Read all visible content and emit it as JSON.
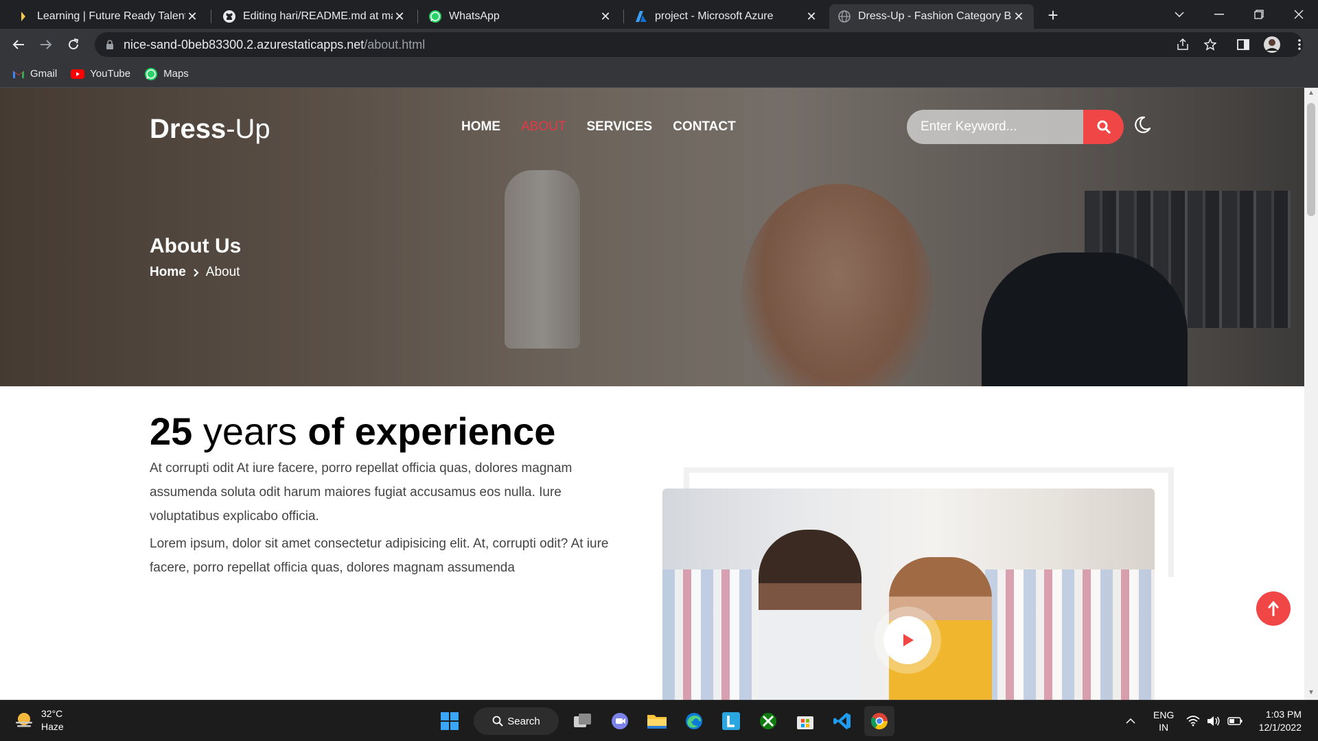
{
  "browser": {
    "tabs": [
      {
        "title": "Learning | Future Ready Talent",
        "icon": "future-ready-talent-icon"
      },
      {
        "title": "Editing hari/README.md at main",
        "icon": "github-icon"
      },
      {
        "title": "WhatsApp",
        "icon": "whatsapp-icon"
      },
      {
        "title": "project - Microsoft Azure",
        "icon": "azure-icon"
      },
      {
        "title": "Dress-Up - Fashion Category Boo",
        "icon": "globe-icon",
        "active": true
      }
    ],
    "url_host": "nice-sand-0beb83300.2.azurestaticapps.net",
    "url_path": "/about.html",
    "bookmarks": [
      {
        "label": "Gmail",
        "icon": "gmail-icon"
      },
      {
        "label": "YouTube",
        "icon": "youtube-icon"
      },
      {
        "label": "Maps",
        "icon": "maps-icon"
      }
    ]
  },
  "site": {
    "logo_bold": "Dress",
    "logo_light": "-Up",
    "nav": [
      "HOME",
      "ABOUT",
      "SERVICES",
      "CONTACT"
    ],
    "nav_current": "ABOUT",
    "search_placeholder": "Enter Keyword...",
    "accent": "#f04646"
  },
  "hero": {
    "title": "About Us",
    "breadcrumb_home": "Home",
    "breadcrumb_current": "About"
  },
  "about": {
    "headline_num": "25",
    "headline_light": "years",
    "headline_bold": "of experience",
    "para1": "At corrupti odit At iure facere, porro repellat officia quas, dolores magnam assumenda soluta odit harum maiores fugiat accusamus eos nulla. Iure voluptatibus explicabo officia.",
    "para2": "Lorem ipsum, dolor sit amet consectetur adipisicing elit. At, corrupti odit? At iure facere, porro repellat officia quas, dolores magnam assumenda"
  },
  "taskbar": {
    "temp": "32°C",
    "condition": "Haze",
    "search_label": "Search",
    "lang": "ENG",
    "region": "IN",
    "time": "1:03 PM",
    "date": "12/1/2022"
  }
}
